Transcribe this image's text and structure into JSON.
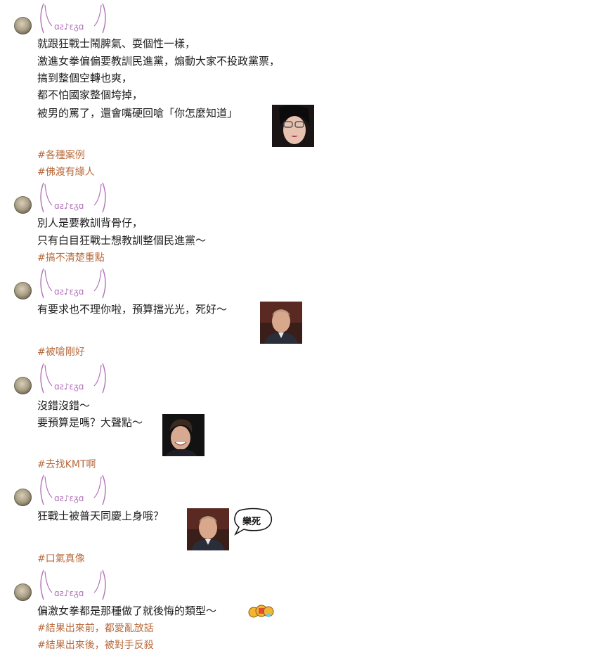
{
  "username_kaomoji": "( ╲╲ ᵒ̌⩬̱ˏ ╱╱ )",
  "posts": [
    {
      "lines": [
        "就跟狂戰士鬧脾氣、耍個性一樣，",
        "激進女拳偏偏要教訓民進黨，煽動大家不投政黨票，",
        "搞到整個空轉也爽，",
        "都不怕國家整個垮掉，",
        "被男的罵了，還會嘴硬回嗆「你怎麼知道」"
      ],
      "tags": [
        "#各種案例",
        "#佛渡有緣人"
      ],
      "stickers": [
        "sticker-woman-glasses"
      ]
    },
    {
      "lines": [
        "別人是要教訓背骨仔，",
        "只有白目狂戰士想教訓整個民進黨～"
      ],
      "tags": [
        "#搞不清楚重點"
      ],
      "stickers": []
    },
    {
      "lines": [
        "有要求也不理你啦，預算擋光光，死好～"
      ],
      "tags": [
        "#被嗆剛好"
      ],
      "stickers": [
        "sticker-putin"
      ]
    },
    {
      "lines": [
        "沒錯沒錯～",
        "要預算是嗎？大聲點～"
      ],
      "tags": [
        "#去找KMT啊"
      ],
      "stickers": [
        "sticker-laughing-man"
      ]
    },
    {
      "lines": [
        "狂戰士被普天同慶上身哦？"
      ],
      "tags": [
        "#口氣真像"
      ],
      "stickers": [
        "sticker-putin",
        "speech-bubble"
      ],
      "bubble_text": "樂死"
    },
    {
      "lines": [
        "偏激女拳都是那種做了就後悔的類型～"
      ],
      "tags": [
        "#結果出來前，都愛亂放話",
        "#結果出來後，被對手反殺"
      ],
      "stickers": [
        "sticker-emoji"
      ]
    }
  ],
  "colors": {
    "tag": "#b86a3c",
    "kaomoji": "#b070b8",
    "text": "#1c1c1c"
  }
}
